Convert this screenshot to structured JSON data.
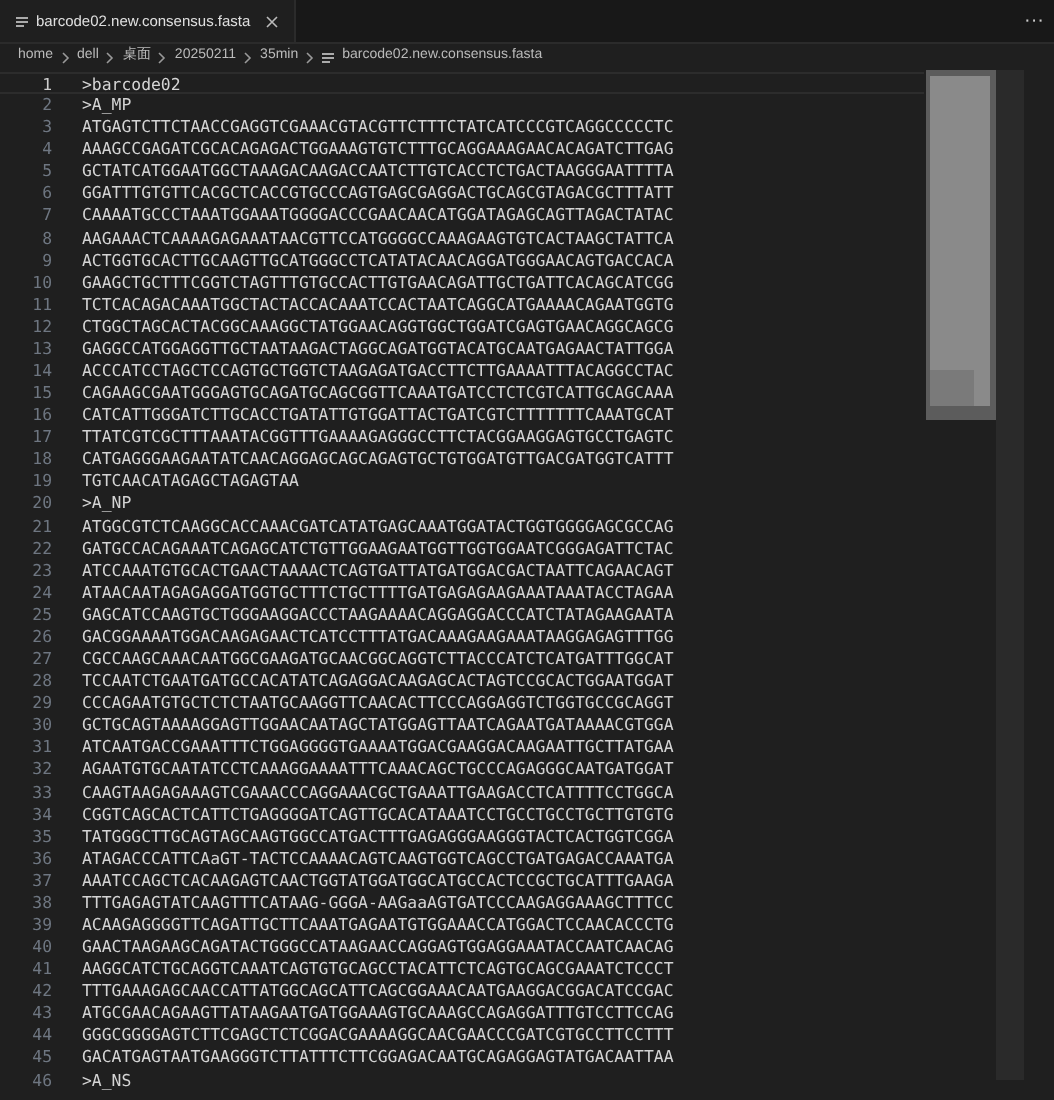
{
  "tabs": [
    {
      "label": "barcode02.new.consensus.fasta",
      "selected": true
    }
  ],
  "more_actions": "···",
  "breadcrumb": [
    "home",
    "dell",
    "桌面",
    "20250211",
    "35min",
    "barcode02.new.consensus.fasta"
  ],
  "lines": [
    {
      "number": "1",
      "text": ">barcode02",
      "active": true
    },
    {
      "number": "2",
      "text": ">A_MP",
      "active": false
    },
    {
      "number": "3",
      "text": "ATGAGTCTTCTAACCGAGGTCGAAACGTACGTTCTTTCTATCATCCCGTCAGGCCCCCTC",
      "active": false
    },
    {
      "number": "4",
      "text": "AAAGCCGAGATCGCACAGAGACTGGAAAGTGTCTTTGCAGGAAAGAACACAGATCTTGAG",
      "active": false
    },
    {
      "number": "5",
      "text": "GCTATCATGGAATGGCTAAAGACAAGACCAATCTTGTCACCTCTGACTAAGGGAATTTTA",
      "active": false
    },
    {
      "number": "6",
      "text": "GGATTTGTGTTCACGCTCACCGTGCCCAGTGAGCGAGGACTGCAGCGTAGACGCTTTATT",
      "active": false
    },
    {
      "number": "7",
      "text": "CAAAATGCCCTAAATGGAAATGGGGACCCGAACAACATGGATAGAGCAGTTAGACTATAC",
      "active": false
    },
    {
      "number": "8",
      "text": "AAGAAACTCAAAAGAGAAATAACGTTCCATGGGGCCAAAGAAGTGTCACTAAGCTATTCA",
      "active": false
    },
    {
      "number": "9",
      "text": "ACTGGTGCACTTGCAAGTTGCATGGGCCTCATATACAACAGGATGGGAACAGTGACCACA",
      "active": false
    },
    {
      "number": "10",
      "text": "GAAGCTGCTTTCGGTCTAGTTTGTGCCACTTGTGAACAGATTGCTGATTCACAGCATCGG",
      "active": false
    },
    {
      "number": "11",
      "text": "TCTCACAGACAAATGGCTACTACCACAAATCCACTAATCAGGCATGAAAACAGAATGGTG",
      "active": false
    },
    {
      "number": "12",
      "text": "CTGGCTAGCACTACGGCAAAGGCTATGGAACAGGTGGCTGGATCGAGTGAACAGGCAGCG",
      "active": false
    },
    {
      "number": "13",
      "text": "GAGGCCATGGAGGTTGCTAATAAGACTAGGCAGATGGTACATGCAATGAGAACTATTGGA",
      "active": false
    },
    {
      "number": "14",
      "text": "ACCCATCCTAGCTCCAGTGCTGGTCTAAGAGATGACCTTCTTGAAAATTTACAGGCCTAC",
      "active": false
    },
    {
      "number": "15",
      "text": "CAGAAGCGAATGGGAGTGCAGATGCAGCGGTTCAAATGATCCTCTCGTCATTGCAGCAAA",
      "active": false
    },
    {
      "number": "16",
      "text": "CATCATTGGGATCTTGCACCTGATATTGTGGATTACTGATCGTCTTTTTTTCAAATGCAT",
      "active": false
    },
    {
      "number": "17",
      "text": "TTATCGTCGCTTTAAATACGGTTTGAAAAGAGGGCCTTCTACGGAAGGAGTGCCTGAGTC",
      "active": false
    },
    {
      "number": "18",
      "text": "CATGAGGGAAGAATATCAACAGGAGCAGCAGAGTGCTGTGGATGTTGACGATGGTCATTT",
      "active": false
    },
    {
      "number": "19",
      "text": "TGTCAACATAGAGCTAGAGTAA",
      "active": false
    },
    {
      "number": "20",
      "text": ">A_NP",
      "active": false
    },
    {
      "number": "21",
      "text": "ATGGCGTCTCAAGGCACCAAACGATCATATGAGCAAATGGATACTGGTGGGGAGCGCCAG",
      "active": false
    },
    {
      "number": "22",
      "text": "GATGCCACAGAAATCAGAGCATCTGTTGGAAGAATGGTTGGTGGAATCGGGAGATTCTAC",
      "active": false
    },
    {
      "number": "23",
      "text": "ATCCAAATGTGCACTGAACTAAAACTCAGTGATTATGATGGACGACTAATTCAGAACAGT",
      "active": false
    },
    {
      "number": "24",
      "text": "ATAACAATAGAGAGGATGGTGCTTTCTGCTTTTGATGAGAGAAGAAATAAATACCTAGAA",
      "active": false
    },
    {
      "number": "25",
      "text": "GAGCATCCAAGTGCTGGGAAGGACCCTAAGAAAACAGGAGGACCCATCTATAGAAGAATA",
      "active": false
    },
    {
      "number": "26",
      "text": "GACGGAAAATGGACAAGAGAACTCATCCTTTATGACAAAGAAGAAATAAGGAGAGTTTGG",
      "active": false
    },
    {
      "number": "27",
      "text": "CGCCAAGCAAACAATGGCGAAGATGCAACGGCAGGTCTTACCCATCTCATGATTTGGCAT",
      "active": false
    },
    {
      "number": "28",
      "text": "TCCAATCTGAATGATGCCACATATCAGAGGACAAGAGCACTAGTCCGCACTGGAATGGAT",
      "active": false
    },
    {
      "number": "29",
      "text": "CCCAGAATGTGCTCTCTAATGCAAGGTTCAACACTTCCCAGGAGGTCTGGTGCCGCAGGT",
      "active": false
    },
    {
      "number": "30",
      "text": "GCTGCAGTAAAAGGAGTTGGAACAATAGCTATGGAGTTAATCAGAATGATAAAACGTGGA",
      "active": false
    },
    {
      "number": "31",
      "text": "ATCAATGACCGAAATTTCTGGAGGGGTGAAAATGGACGAAGGACAAGAATTGCTTATGAA",
      "active": false
    },
    {
      "number": "32",
      "text": "AGAATGTGCAATATCCTCAAAGGAAAATTTCAAACAGCTGCCCAGAGGGCAATGATGGAT",
      "active": false
    },
    {
      "number": "33",
      "text": "CAAGTAAGAGAAAGTCGAAACCCAGGAAACGCTGAAATTGAAGACCTCATTTTCCTGGCA",
      "active": false
    },
    {
      "number": "34",
      "text": "CGGTCAGCACTCATTCTGAGGGGATCAGTTGCACATAAATCCTGCCTGCCTGCTTGTGTG",
      "active": false
    },
    {
      "number": "35",
      "text": "TATGGGCTTGCAGTAGCAAGTGGCCATGACTTTGAGAGGGAAGGGTACTCACTGGTCGGA",
      "active": false
    },
    {
      "number": "36",
      "text": "ATAGACCCATTCAaGT-TACTCCAAAACAGTCAAGTGGTCAGCCTGATGAGACCAAATGA",
      "active": false
    },
    {
      "number": "37",
      "text": "AAATCCAGCTCACAAGAGTCAACTGGTATGGATGGCATGCCACTCCGCTGCATTTGAAGA",
      "active": false
    },
    {
      "number": "38",
      "text": "TTTGAGAGTATCAAGTTTCATAAG-GGGA-AAGaaAGTGATCCCAAGAGGAAAGCTTTCC",
      "active": false
    },
    {
      "number": "39",
      "text": "ACAAGAGGGGTTCAGATTGCTTCAAATGAGAATGTGGAAACCATGGACTCCAACACCCTG",
      "active": false
    },
    {
      "number": "40",
      "text": "GAACTAAGAAGCAGATACTGGGCCATAAGAACCAGGAGTGGAGGAAATACCAATCAACAG",
      "active": false
    },
    {
      "number": "41",
      "text": "AAGGCATCTGCAGGTCAAATCAGTGTGCAGCCTACATTCTCAGTGCAGCGAAATCTCCCT",
      "active": false
    },
    {
      "number": "42",
      "text": "TTTGAAAGAGCAACCATTATGGCAGCATTCAGCGGAAACAATGAAGGACGGACATCCGAC",
      "active": false
    },
    {
      "number": "43",
      "text": "ATGCGAACAGAAGTTATAAGAATGATGGAAAGTGCAAAGCCAGAGGATTTGTCCTTCCAG",
      "active": false
    },
    {
      "number": "44",
      "text": "GGGCGGGGAGTCTTCGAGCTCTCGGACGAAAAGGCAACGAACCCGATCGTGCCTTCCTTT",
      "active": false
    },
    {
      "number": "45",
      "text": "GACATGAGTAATGAAGGGTCTTATTTCTTCGGAGACAATGCAGAGGAGTATGACAATTAA",
      "active": false
    },
    {
      "number": "46",
      "text": ">A_NS",
      "active": false
    }
  ]
}
